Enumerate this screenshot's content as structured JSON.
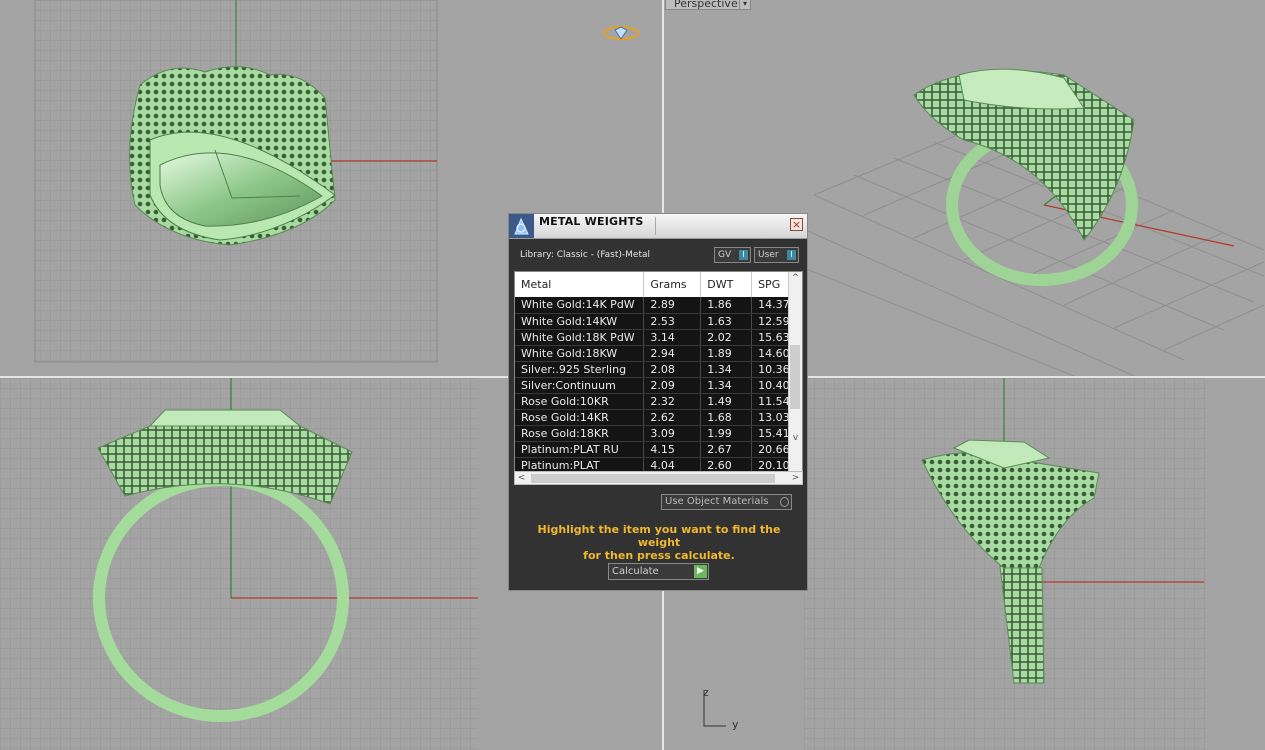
{
  "viewports": {
    "perspective_label": "Perspective",
    "axis_labels": {
      "z": "z",
      "y": "y"
    }
  },
  "colors": {
    "model": "#a8e0a0",
    "dialog_bg": "#323232",
    "hint": "#f0b830",
    "accent_toggle": "#3b8aa0",
    "go": "#6ab85c"
  },
  "dialog": {
    "title": "METAL WEIGHTS",
    "close_icon": "close-icon",
    "library_label": "Library: Classic - (Fast)-Metal",
    "toggle_gv": "GV",
    "toggle_user": "User",
    "columns": [
      "Metal",
      "Grams",
      "DWT",
      "SPG"
    ],
    "rows": [
      [
        "White Gold:14K PdW",
        "2.89",
        "1.86",
        "14.37"
      ],
      [
        "White Gold:14KW",
        "2.53",
        "1.63",
        "12.59"
      ],
      [
        "White Gold:18K PdW",
        "3.14",
        "2.02",
        "15.63"
      ],
      [
        "White Gold:18KW",
        "2.94",
        "1.89",
        "14.60"
      ],
      [
        "Silver:.925 Sterling",
        "2.08",
        "1.34",
        "10.36"
      ],
      [
        "Silver:Continuum",
        "2.09",
        "1.34",
        "10.40"
      ],
      [
        "Rose Gold:10KR",
        "2.32",
        "1.49",
        "11.54"
      ],
      [
        "Rose Gold:14KR",
        "2.62",
        "1.68",
        "13.03"
      ],
      [
        "Rose Gold:18KR",
        "3.09",
        "1.99",
        "15.41"
      ],
      [
        "Platinum:PLAT RU",
        "4.15",
        "2.67",
        "20.66"
      ],
      [
        "Platinum:PLAT",
        "4.04",
        "2.60",
        "20.10"
      ]
    ],
    "use_object_materials": "Use Object Materials",
    "hint_line1": "Highlight the item you want to find the weight",
    "hint_line2": "for then press calculate.",
    "calculate_label": "Calculate"
  }
}
